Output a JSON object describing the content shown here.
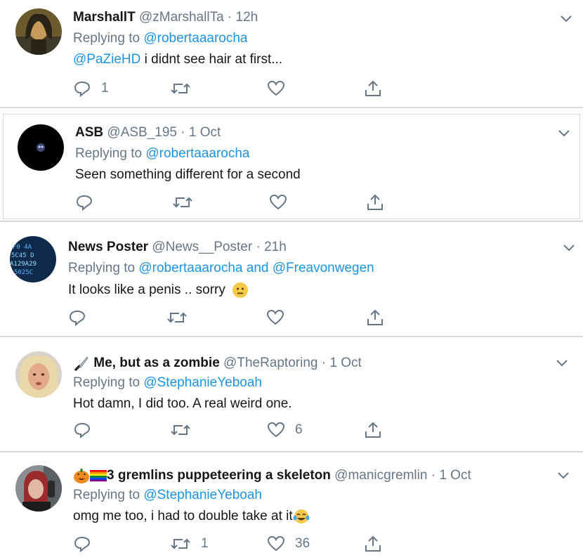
{
  "tweets": [
    {
      "name": "MarshallT",
      "handle": "@zMarshallTa",
      "time": "12h",
      "replying_prefix": "Replying to",
      "replying_to": [
        "@robertaaarocha"
      ],
      "text_mention": "@PaZieHD",
      "text": "i didnt see hair at first...",
      "reply_count": "1",
      "retweet_count": "",
      "like_count": ""
    },
    {
      "name": "ASB",
      "handle": "@ASB_195",
      "time": "1 Oct",
      "replying_prefix": "Replying to",
      "replying_to": [
        "@robertaaarocha"
      ],
      "text": "Seen something different for a second",
      "reply_count": "",
      "retweet_count": "",
      "like_count": ""
    },
    {
      "name": "News Poster",
      "handle": "@News__Poster",
      "time": "21h",
      "replying_prefix": "Replying to",
      "replying_to": [
        "@robertaaarocha",
        "@Freavonwegen"
      ],
      "replying_joiner": "and",
      "text": "It looks like a penis .. sorry",
      "reply_count": "",
      "retweet_count": "",
      "like_count": ""
    },
    {
      "name": "Me, but as a zombie",
      "handle": "@TheRaptoring",
      "time": "1 Oct",
      "replying_prefix": "Replying to",
      "replying_to": [
        "@StephanieYeboah"
      ],
      "text": "Hot damn, I did too. A real weird one.",
      "reply_count": "",
      "retweet_count": "",
      "like_count": "6"
    },
    {
      "name": "3 gremlins puppeteering a skeleton",
      "handle": "@manicgremlin",
      "time": "1 Oct",
      "replying_prefix": "Replying to",
      "replying_to": [
        "@StephanieYeboah"
      ],
      "text": "omg me too, i had to double take at it",
      "reply_count": "",
      "retweet_count": "1",
      "like_count": "36"
    }
  ],
  "separator_dot": "·",
  "colors": {
    "accent": "#1b95e0",
    "muted": "#657786",
    "text": "#14171a",
    "separator": "#d7dbdf"
  },
  "icons": [
    "reply-icon",
    "retweet-icon",
    "like-icon",
    "share-icon",
    "caret-down-icon",
    "knife-emoji",
    "jack-o-lantern-emoji",
    "rainbow-flag-emoji",
    "neutral-face-emoji",
    "tears-of-joy-emoji"
  ]
}
